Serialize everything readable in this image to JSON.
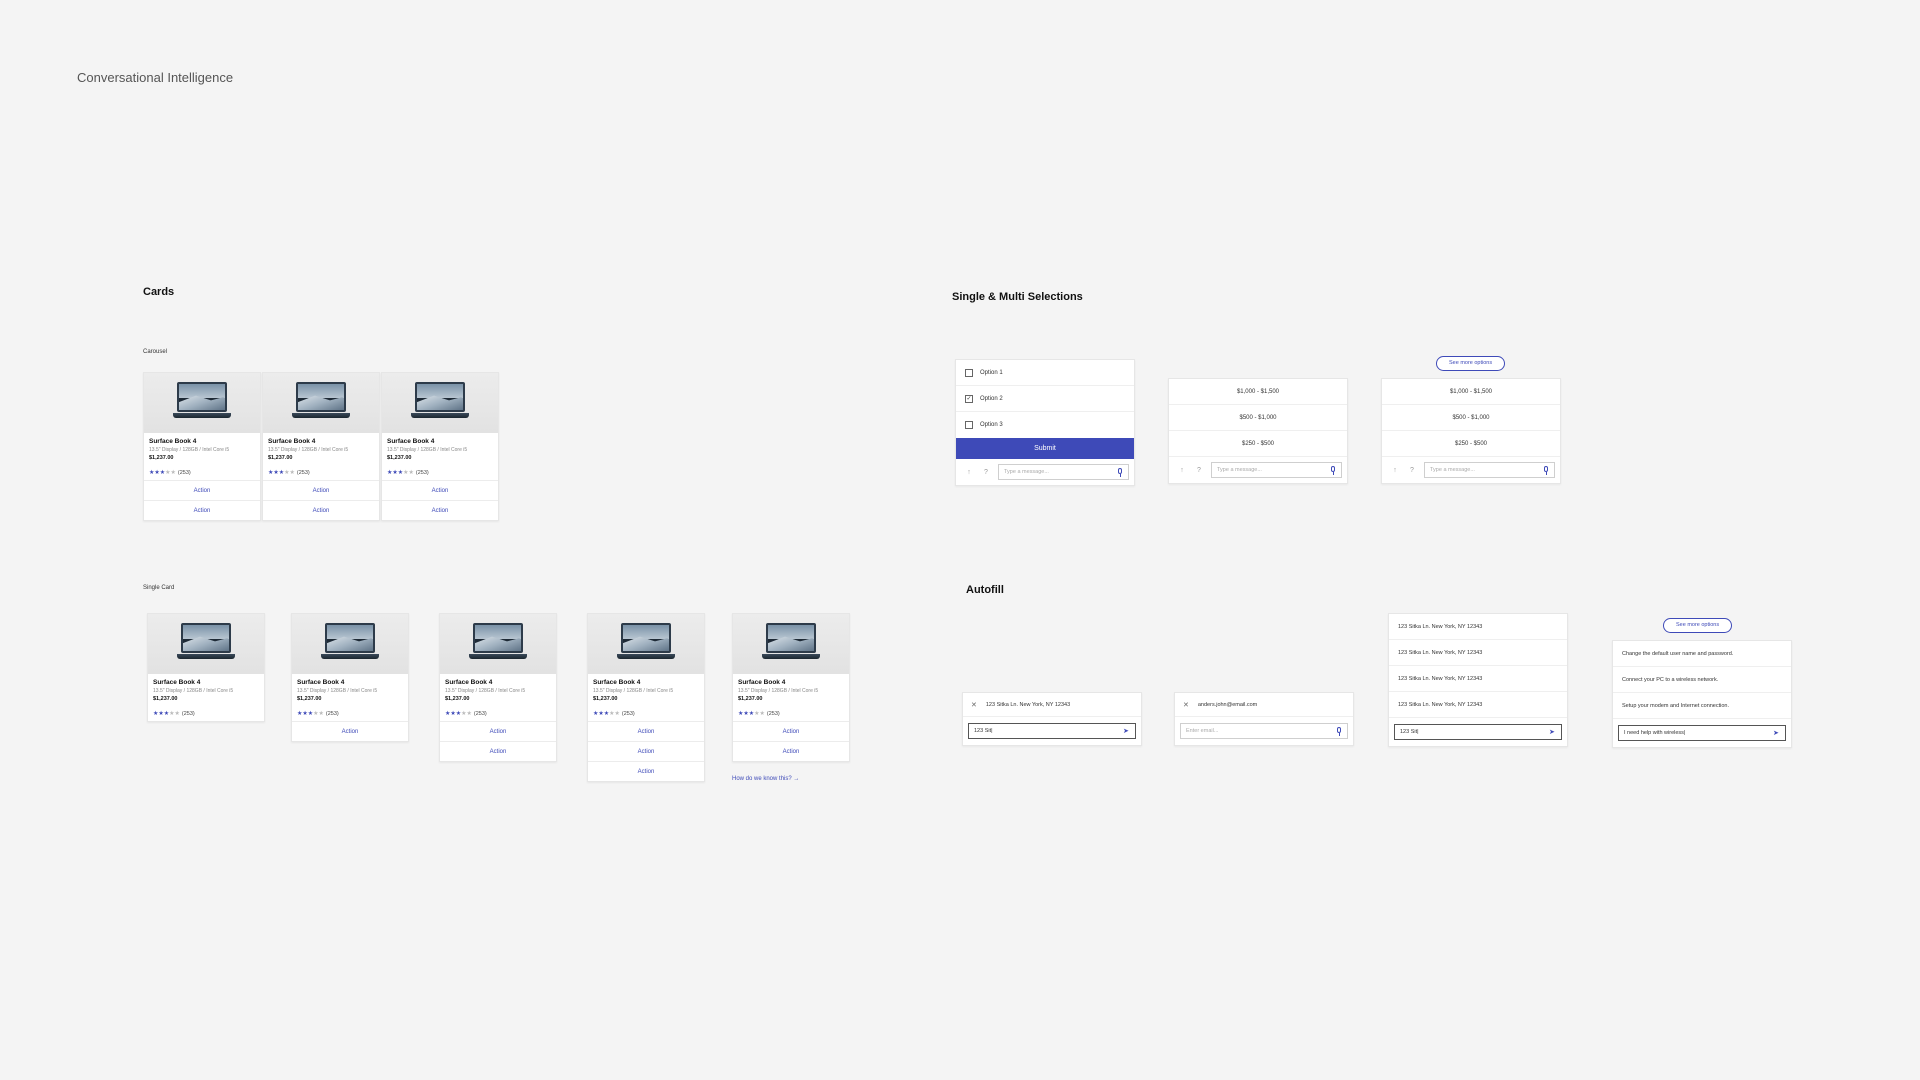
{
  "page": {
    "title": "Conversational Intelligence"
  },
  "cards": {
    "title": "Cards",
    "carousel_label": "Carousel",
    "single_label": "Single Card",
    "product": {
      "name": "Surface Book 4",
      "spec": "13.5\" Display / 128GB / Intel Core i5",
      "price": "$1,237.00",
      "rating": 3,
      "rating_max": 5,
      "review_count": "(253)"
    },
    "action_label": "Action",
    "how_link": "How do we know this? →"
  },
  "selections": {
    "title": "Single & Multi Selections",
    "options": [
      "Option 1",
      "Option 2",
      "Option 3"
    ],
    "checked_index": 1,
    "submit_label": "Submit",
    "price_ranges": [
      "$1,000 - $1,500",
      "$500 - $1,000",
      "$250 - $500"
    ],
    "see_more": "See more options",
    "message_placeholder": "Type a message...",
    "pin_glyph": "↑",
    "help_glyph": "?"
  },
  "autofill": {
    "title": "Autofill",
    "address_chip": "123 Sitka Ln. New York, NY 12343",
    "address_input": "123 Sit|",
    "email_chip": "anders.john@email.com",
    "email_placeholder": "Enter email...",
    "address_suggestions": [
      "123 Sitka Ln. New York, NY 12343",
      "123 Sitka Ln. New York, NY 12343",
      "123 Sitka Ln. New York, NY 12343",
      "123 Sitka Ln. New York, NY 12343"
    ],
    "see_more": "See more options",
    "help_suggestions": [
      "Change the default user name and password.",
      "Connect your PC to a wireless network.",
      "Setup your modem and Internet connection."
    ],
    "help_input": "I need help with wireless|",
    "close_glyph": "✕",
    "send_glyph": "➤"
  }
}
